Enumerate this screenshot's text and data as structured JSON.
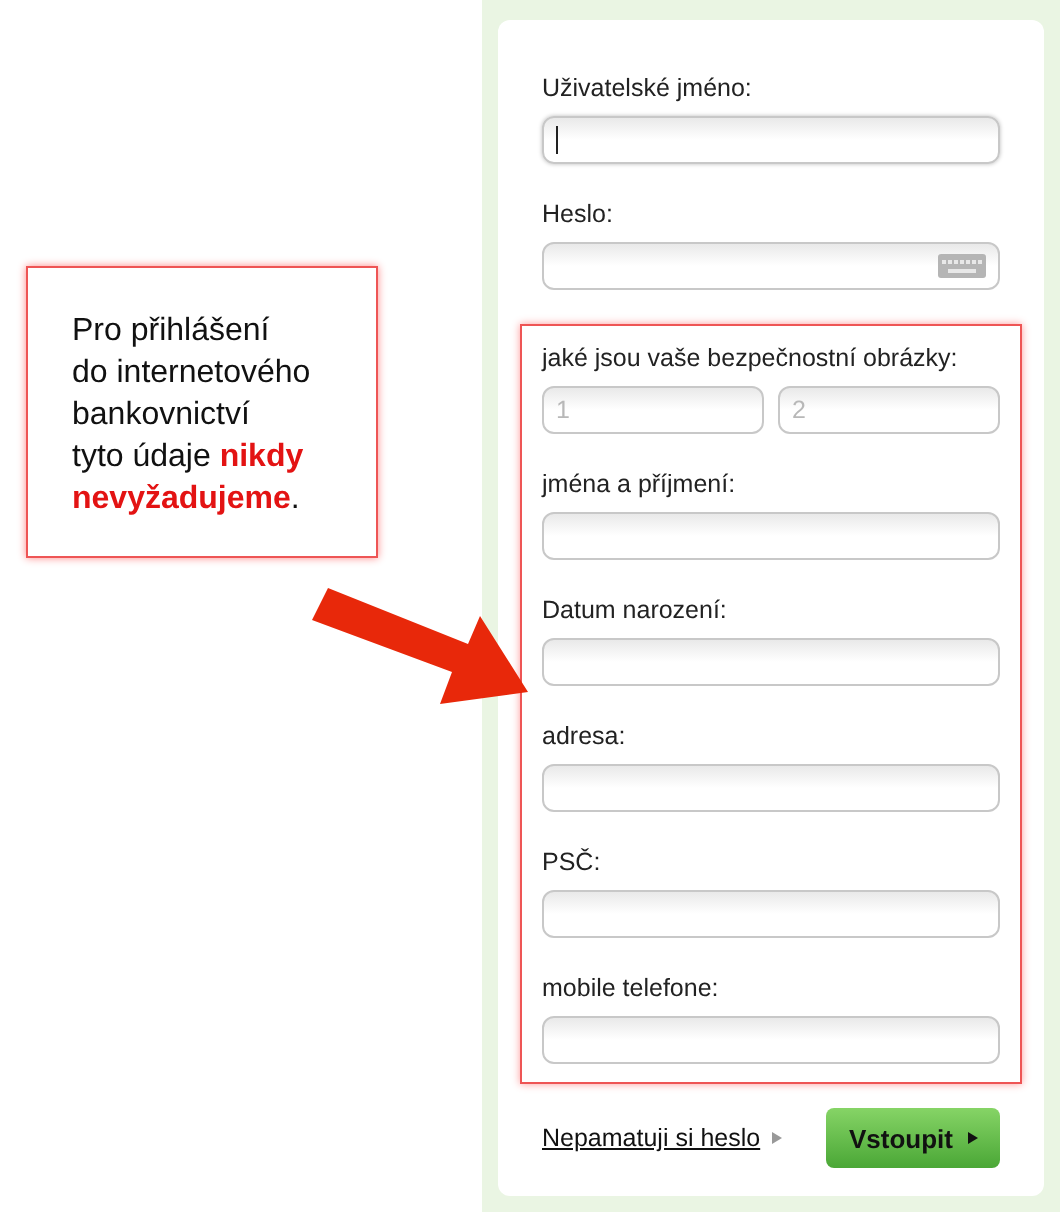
{
  "callout": {
    "text": "Pro přihlášení\ndo internetového\nbankovnictví\ntyto údaje **nikdy**\n**nevyžadujeme**."
  },
  "login": [
    {
      "label": "Uživatelské jméno:",
      "kind": "text",
      "focused": true
    },
    {
      "label": "Heslo:",
      "kind": "password",
      "focused": false
    }
  ],
  "security_section": {
    "fields": [
      {
        "label": "jaké jsou vaše bezpečnostní obrázky:",
        "kind": "pair",
        "placeholders": [
          "1",
          "2"
        ]
      },
      {
        "label": "jména a příjmení:",
        "kind": "text"
      },
      {
        "label": "Datum narození:",
        "kind": "text"
      },
      {
        "label": "adresa:",
        "kind": "text"
      },
      {
        "label": "PSČ:",
        "kind": "text"
      },
      {
        "label": "mobile telefone:",
        "kind": "text"
      }
    ]
  },
  "forgot_link": "Nepamatuji si heslo",
  "submit_button": "Vstoupit"
}
